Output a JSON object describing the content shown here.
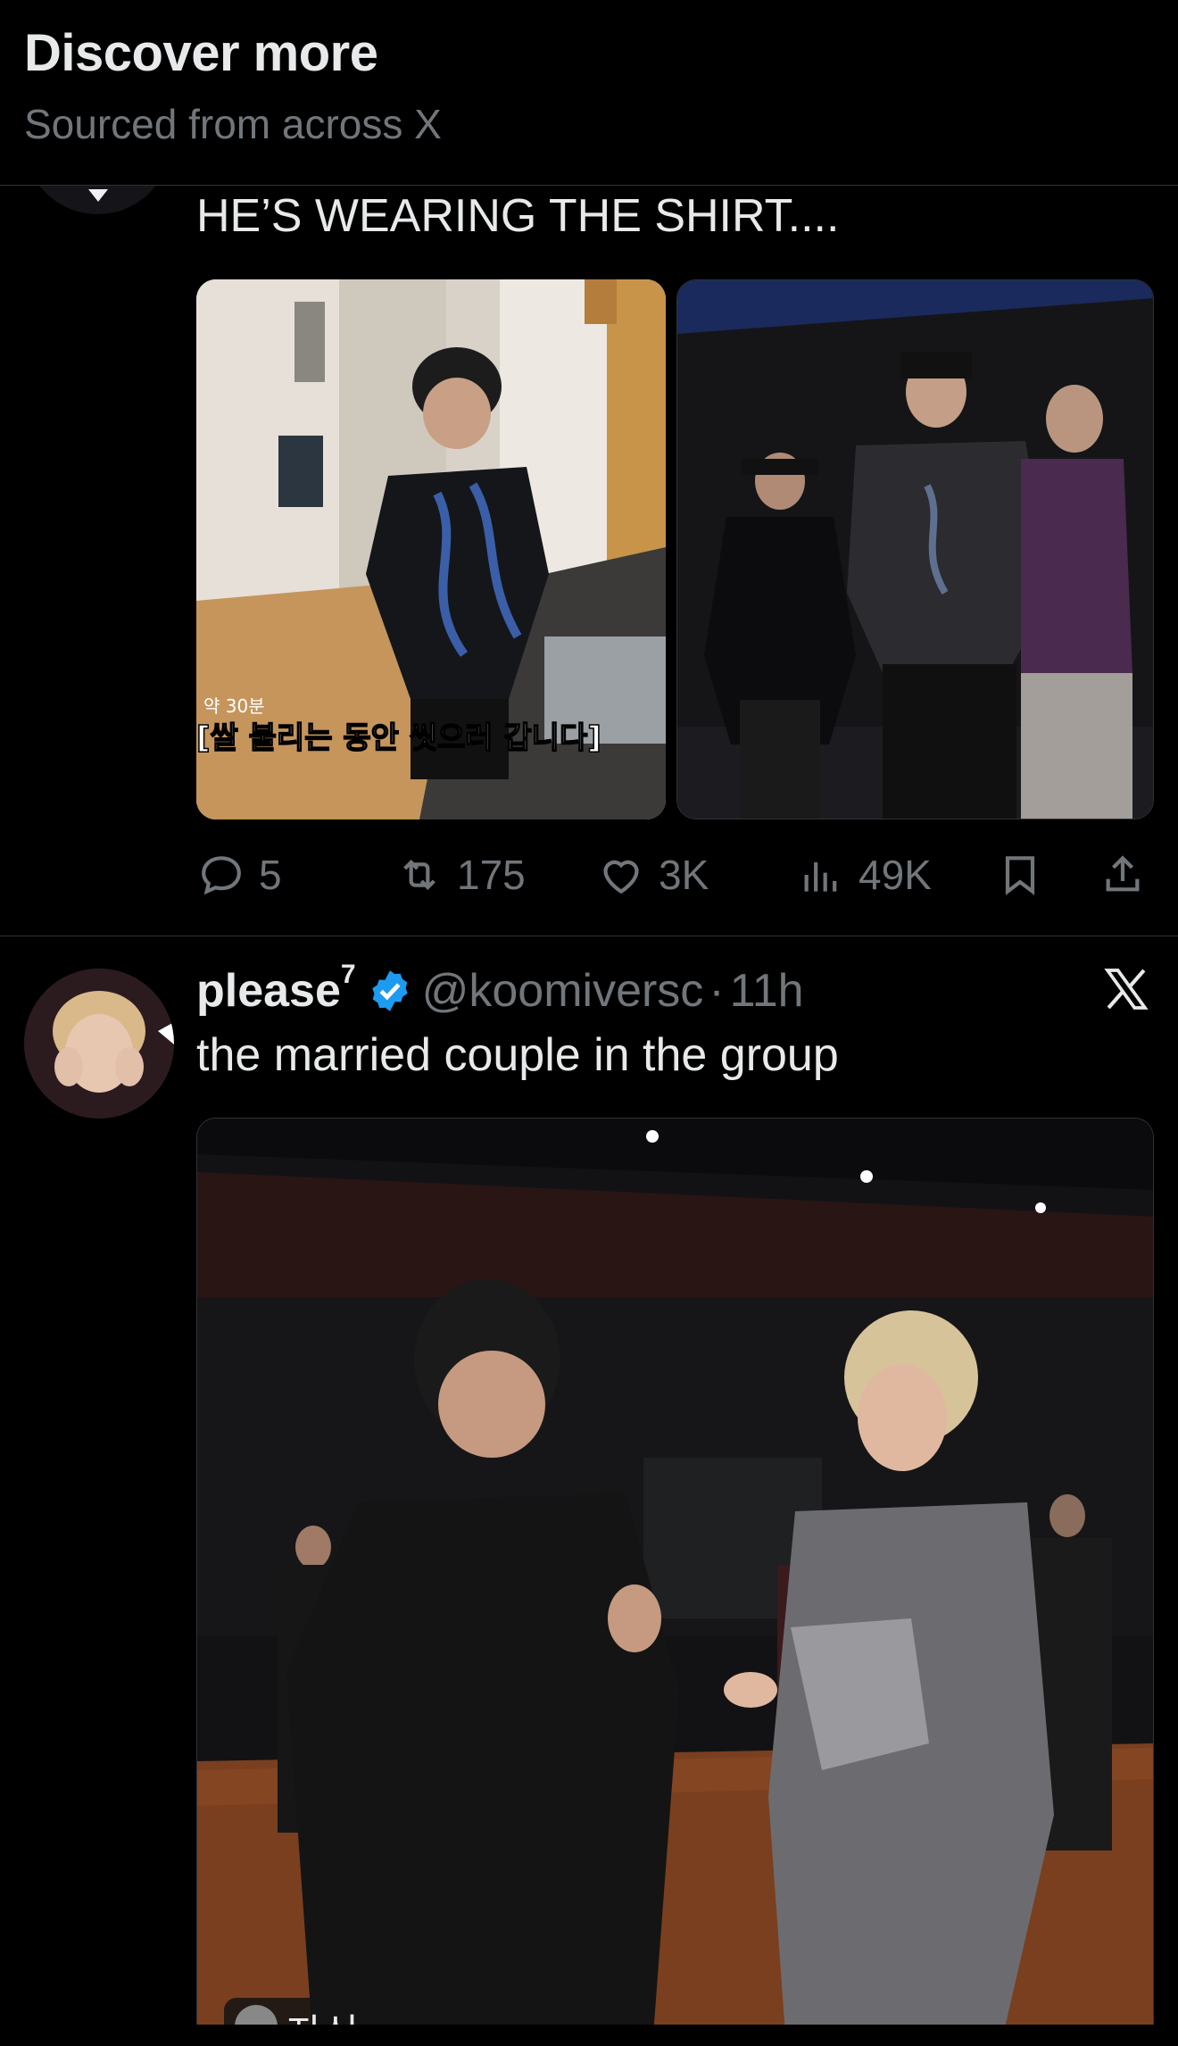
{
  "header": {
    "title": "Discover more",
    "subtitle": "Sourced from across X"
  },
  "tweet1": {
    "text": "HE’S WEARING THE SHIRT....",
    "media": [
      {
        "caption_small": "약 30분",
        "caption": "[쌀 불리는 동안 씻으러 갑니다]"
      },
      {
        "caption": ""
      }
    ],
    "actions": {
      "replies": "5",
      "reposts": "175",
      "likes": "3K",
      "views": "49K"
    }
  },
  "tweet2": {
    "name": "please",
    "name_sup": "7",
    "handle": "@koomiversc",
    "separator": "·",
    "time": "11h",
    "text": "the married couple in the group",
    "media_caption": "자신"
  },
  "icons": {
    "reply": "reply-icon",
    "repost": "repost-icon",
    "like": "heart-icon",
    "views": "views-icon",
    "bookmark": "bookmark-icon",
    "share": "share-icon",
    "verified": "verified-badge-icon",
    "x_logo": "x-logo-icon"
  },
  "colors": {
    "background": "#000000",
    "text": "#e7e9ea",
    "muted": "#71767b",
    "verified": "#1d9bf0",
    "divider": "#2f3336"
  }
}
